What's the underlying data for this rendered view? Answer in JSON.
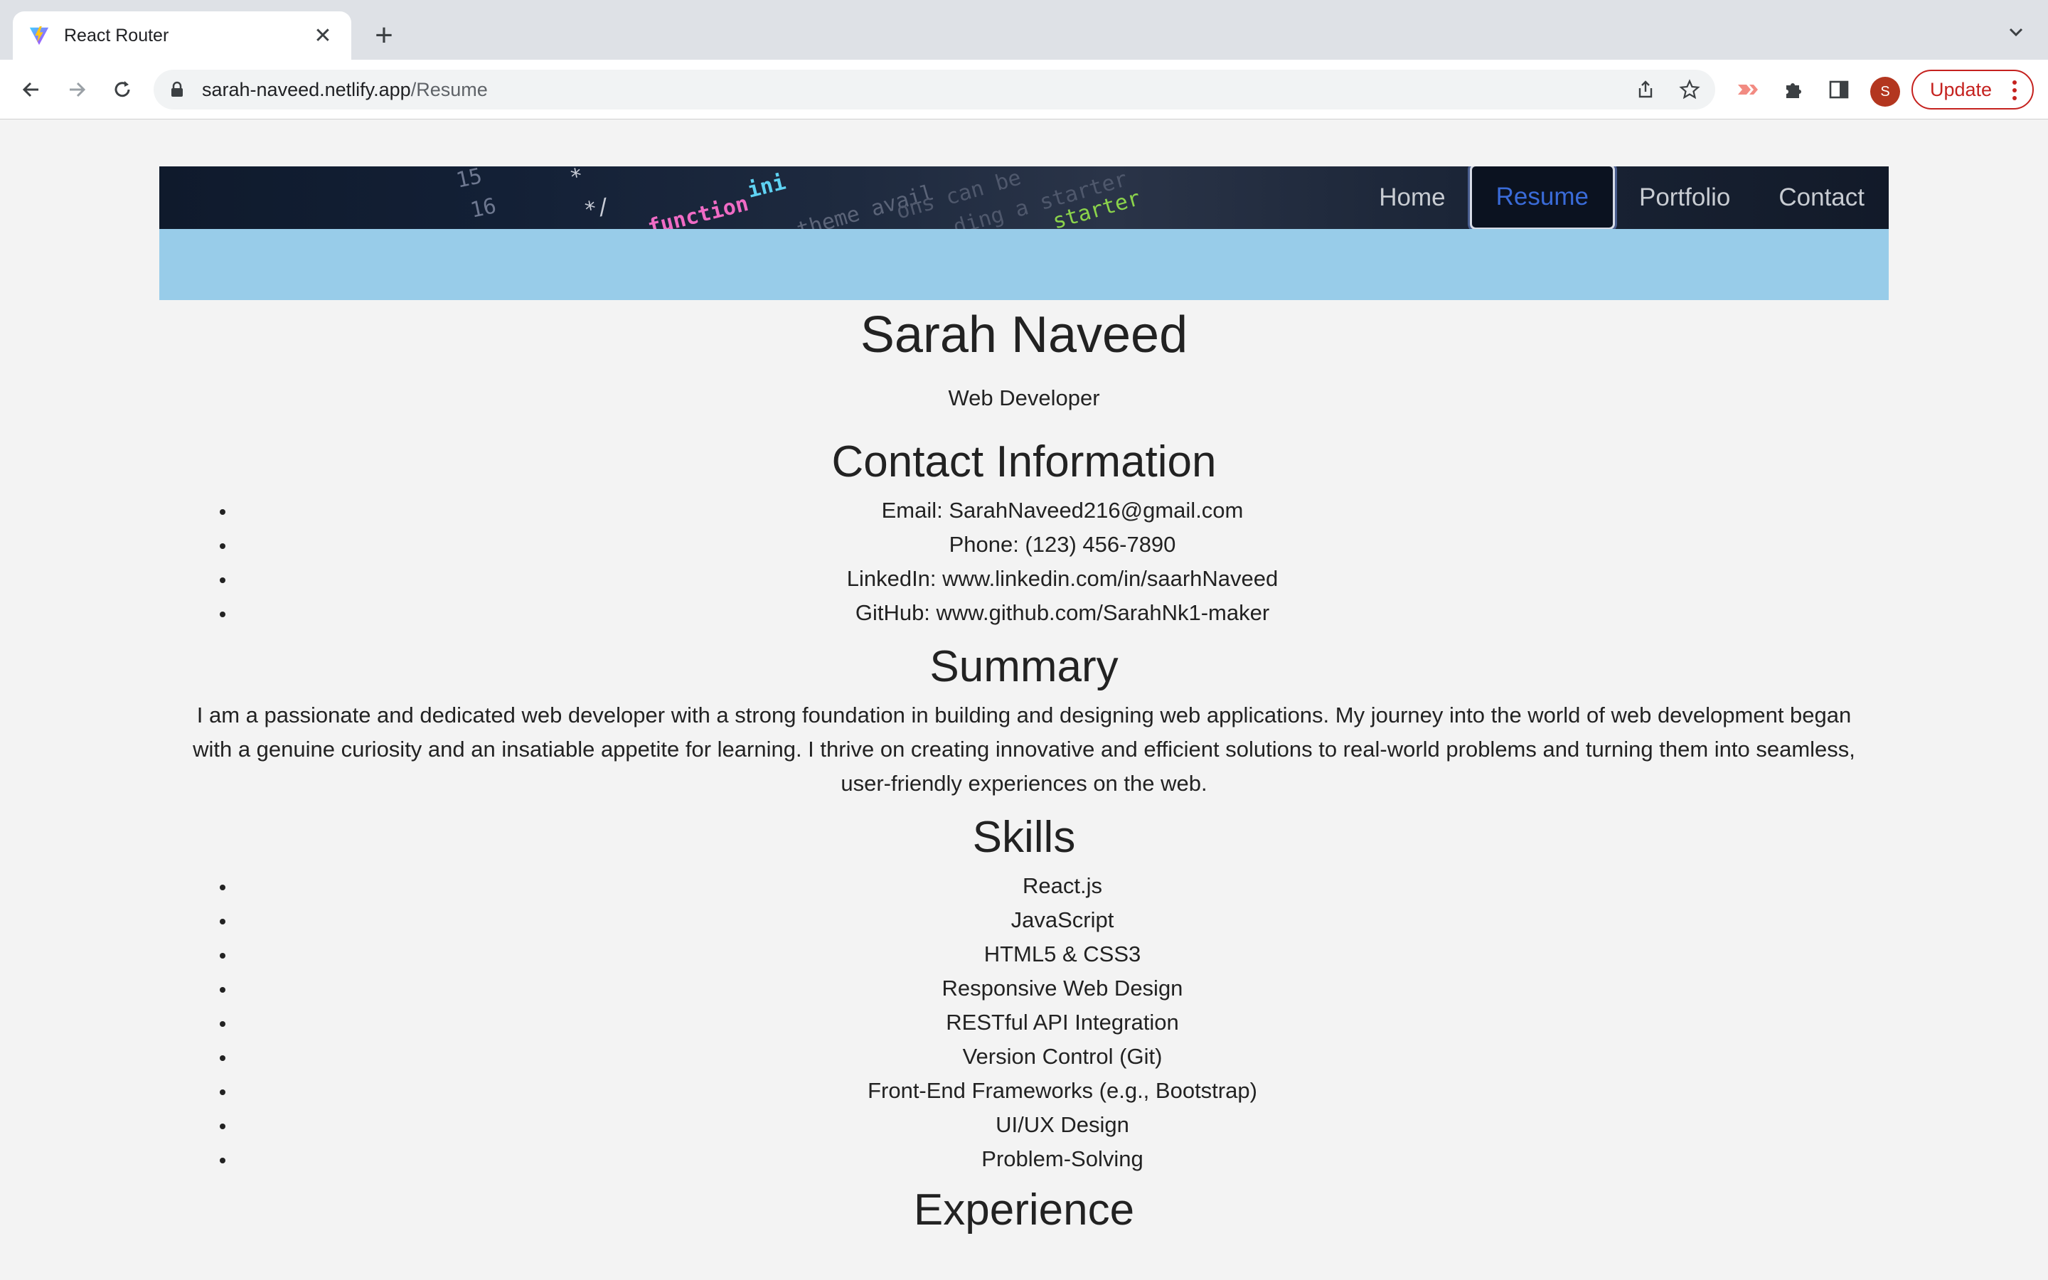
{
  "browser": {
    "tab_title": "React Router",
    "url_host": "sarah-naveed.netlify.app",
    "url_path": "/Resume",
    "update_label": "Update",
    "avatar_letter": "S"
  },
  "nav": {
    "items": [
      "Home",
      "Resume",
      "Portfolio",
      "Contact"
    ],
    "active": "Resume"
  },
  "resume": {
    "name": "Sarah Naveed",
    "role": "Web Developer",
    "contact_heading": "Contact Information",
    "contact": [
      "Email: SarahNaveed216@gmail.com",
      "Phone: (123) 456-7890",
      "LinkedIn: www.linkedin.com/in/saarhNaveed",
      "GitHub: www.github.com/SarahNk1-maker"
    ],
    "summary_heading": "Summary",
    "summary": "I am a passionate and dedicated web developer with a strong foundation in building and designing web applications. My journey into the world of web development began with a genuine curiosity and an insatiable appetite for learning. I thrive on creating innovative and efficient solutions to real-world problems and turning them into seamless, user-friendly experiences on the web.",
    "skills_heading": "Skills",
    "skills": [
      "React.js",
      "JavaScript",
      "HTML5 & CSS3",
      "Responsive Web Design",
      "RESTful API Integration",
      "Version Control (Git)",
      "Front-End Frameworks (e.g., Bootstrap)",
      "UI/UX Design",
      "Problem-Solving"
    ],
    "experience_heading": "Experience"
  },
  "colors": {
    "accent_nav_active": "#3a6bd8",
    "blue_band": "#98cce9",
    "update_red": "#c5221f"
  },
  "icons": [
    "vite-favicon",
    "close-icon",
    "plus-icon",
    "chevron-down-icon",
    "back-icon",
    "forward-icon",
    "reload-icon",
    "lock-icon",
    "share-icon",
    "star-icon",
    "extension-icon",
    "puzzle-icon",
    "side-panel-icon",
    "menu-dots-icon"
  ]
}
